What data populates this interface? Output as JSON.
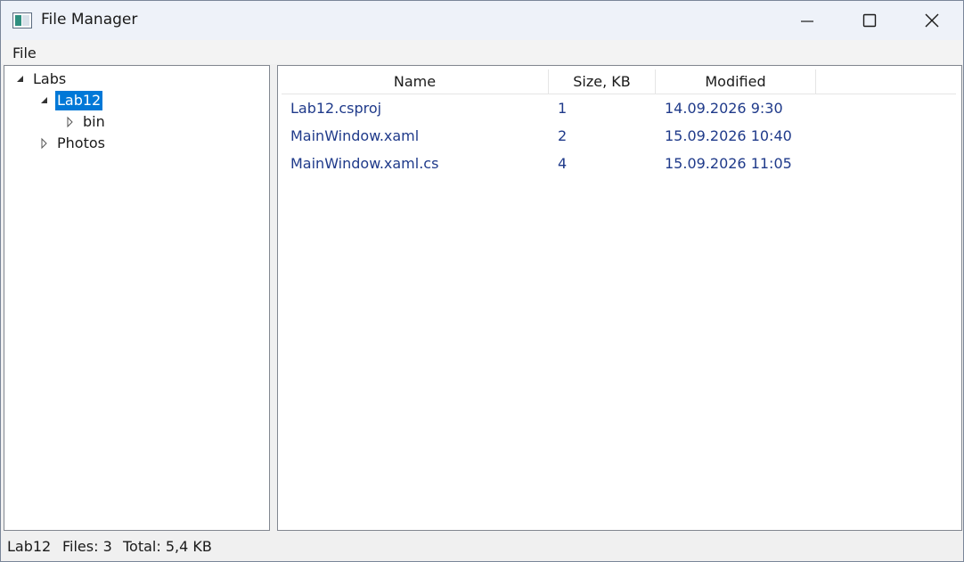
{
  "window": {
    "title": "File Manager"
  },
  "menu": {
    "file_label": "File"
  },
  "tree": {
    "items": [
      {
        "label": "Labs",
        "expanded": true
      },
      {
        "label": "Lab12",
        "expanded": true,
        "selected": true
      },
      {
        "label": "bin",
        "expanded": false
      },
      {
        "label": "Photos",
        "expanded": false
      }
    ]
  },
  "list": {
    "columns": [
      "Name",
      "Size, KB",
      "Modified"
    ],
    "rows": [
      {
        "name": "Lab12.csproj",
        "size": "1",
        "modified": "14.09.2026 9:30"
      },
      {
        "name": "MainWindow.xaml",
        "size": "2",
        "modified": "15.09.2026 10:40"
      },
      {
        "name": "MainWindow.xaml.cs",
        "size": "4",
        "modified": "15.09.2026 11:05"
      }
    ]
  },
  "status": {
    "folder": "Lab12",
    "files": "Files: 3",
    "total": "Total: 5,4 KB"
  },
  "colors": {
    "selection": "#0078d7",
    "list_text": "#1f3a8a"
  }
}
